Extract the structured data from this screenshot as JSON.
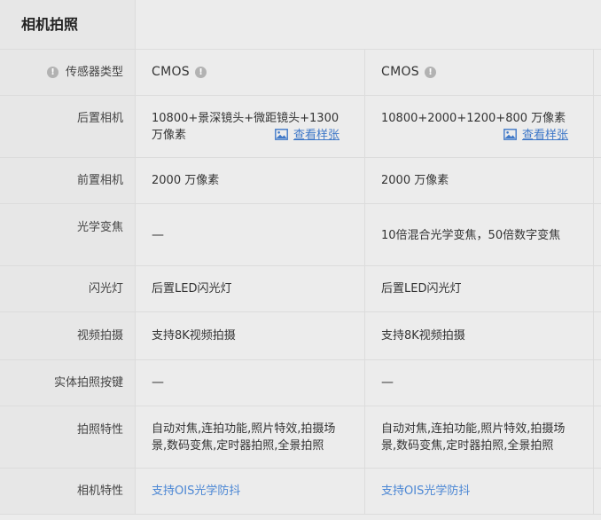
{
  "section": {
    "title": "相机拍照"
  },
  "info_icon_glyph": "!",
  "rows": {
    "sensor": {
      "label": "传感器类型",
      "a": "CMOS",
      "b": "CMOS"
    },
    "rear": {
      "label": "后置相机",
      "a_line1": "10800+景深镜头+微距镜头+1300",
      "a_line2": "万像素",
      "b_line1": "10800+2000+1200+800 万像素",
      "sample_link": "查看样张"
    },
    "front": {
      "label": "前置相机",
      "a": "2000 万像素",
      "b": "2000 万像素"
    },
    "zoom": {
      "label": "光学变焦",
      "a": "—",
      "b": "10倍混合光学变焦，50倍数字变焦"
    },
    "flash": {
      "label": "闪光灯",
      "a": "后置LED闪光灯",
      "b": "后置LED闪光灯"
    },
    "video": {
      "label": "视频拍摄",
      "a": "支持8K视频拍摄",
      "b": "支持8K视频拍摄"
    },
    "shutter": {
      "label": "实体拍照按键",
      "a": "—",
      "b": "—"
    },
    "features": {
      "label": "拍照特性",
      "a_line1": "自动对焦,连拍功能,照片特效,拍摄场",
      "a_line2": "景,数码变焦,定时器拍照,全景拍照",
      "b_line1": "自动对焦,连拍功能,照片特效,拍摄场",
      "b_line2": "景,数码变焦,定时器拍照,全景拍照"
    },
    "camera_feature": {
      "label": "相机特性",
      "a": "支持OIS光学防抖",
      "b": "支持OIS光学防抖"
    }
  },
  "colors": {
    "link": "#3f78c8",
    "accent_blue": "#4a86d4",
    "info_icon": "#b2b2b2"
  },
  "icons": {
    "info": "info-icon",
    "sample_image": "image-icon"
  }
}
